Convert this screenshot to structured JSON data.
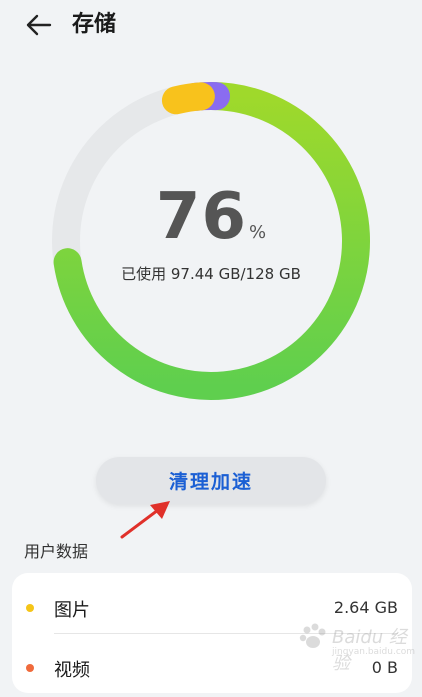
{
  "header": {
    "title": "存储",
    "back_icon": "arrow-left-icon"
  },
  "storage": {
    "used_fraction": 0.76,
    "percent_value": "76",
    "percent_unit": "%",
    "usage_text": "已使用 97.44 GB/128 GB",
    "ring_colors": {
      "track": "#e6e8ea",
      "used": "#7ed957",
      "other_a": "#8a6cf0",
      "other_b": "#f8c21c"
    }
  },
  "actions": {
    "clean_label": "清理加速"
  },
  "user_data": {
    "section_label": "用户数据",
    "rows": [
      {
        "label": "图片",
        "value": "2.64 GB",
        "dot_color": "#f5c518"
      },
      {
        "label": "视频",
        "value": "0 B",
        "dot_color": "#f06a3c"
      }
    ]
  },
  "watermark": {
    "text": "Baidu 经验",
    "sub": "jingyan.baidu.com"
  },
  "colors": {
    "accent_blue": "#1b5fd4",
    "annotation_red": "#e0302a"
  }
}
